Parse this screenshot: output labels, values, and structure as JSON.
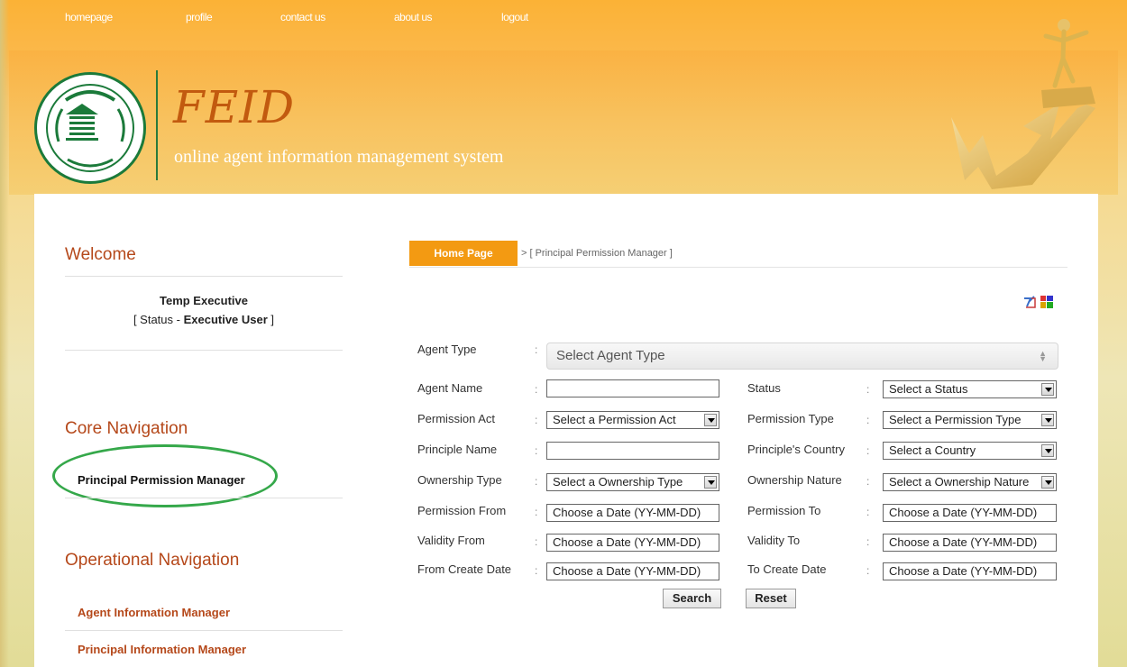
{
  "topnav": [
    "homepage",
    "profile",
    "contact us",
    "about us",
    "logout"
  ],
  "brand": {
    "title": "FEID",
    "subtitle": "online agent information management system"
  },
  "sidebar": {
    "welcome_title": "Welcome",
    "user_name": "Temp Executive",
    "status_prefix": "[ Status - ",
    "status_value": "Executive User",
    "status_suffix": " ]",
    "core_title": "Core Navigation",
    "core_items": [
      "Principal Permission Manager"
    ],
    "op_title": "Operational Navigation",
    "op_items": [
      "Agent Information Manager",
      "Principal Information Manager"
    ]
  },
  "breadcrumb": {
    "home": "Home Page",
    "current": "> [ Principal Permission Manager ]"
  },
  "form": {
    "agent_type": {
      "label": "Agent Type",
      "value": "Select Agent Type"
    },
    "agent_name": {
      "label": "Agent Name",
      "value": ""
    },
    "status": {
      "label": "Status",
      "value": "Select a Status"
    },
    "permission_act": {
      "label": "Permission Act",
      "value": "Select a Permission Act"
    },
    "permission_type": {
      "label": "Permission Type",
      "value": "Select a Permission Type"
    },
    "principle_name": {
      "label": "Principle Name",
      "value": ""
    },
    "principle_country": {
      "label": "Principle's Country",
      "value": "Select a Country"
    },
    "ownership_type": {
      "label": "Ownership Type",
      "value": "Select a Ownership Type"
    },
    "ownership_nature": {
      "label": "Ownership Nature",
      "value": "Select a Ownership Nature"
    },
    "permission_from": {
      "label": "Permission From",
      "placeholder": "Choose a Date (YY-MM-DD)"
    },
    "permission_to": {
      "label": "Permission To",
      "placeholder": "Choose a Date (YY-MM-DD)"
    },
    "validity_from": {
      "label": "Validity From",
      "placeholder": "Choose a Date (YY-MM-DD)"
    },
    "validity_to": {
      "label": "Validity To",
      "placeholder": "Choose a Date (YY-MM-DD)"
    },
    "from_create_date": {
      "label": "From Create Date",
      "placeholder": "Choose a Date (YY-MM-DD)"
    },
    "to_create_date": {
      "label": "To Create Date",
      "placeholder": "Choose a Date (YY-MM-DD)"
    },
    "colon": ":",
    "search_label": "Search",
    "reset_label": "Reset"
  },
  "colors": {
    "accent": "#f39a12",
    "heading": "#b5481a",
    "highlight_ellipse": "#35a84a"
  },
  "icons": [
    "export-icon",
    "grid-icon"
  ]
}
